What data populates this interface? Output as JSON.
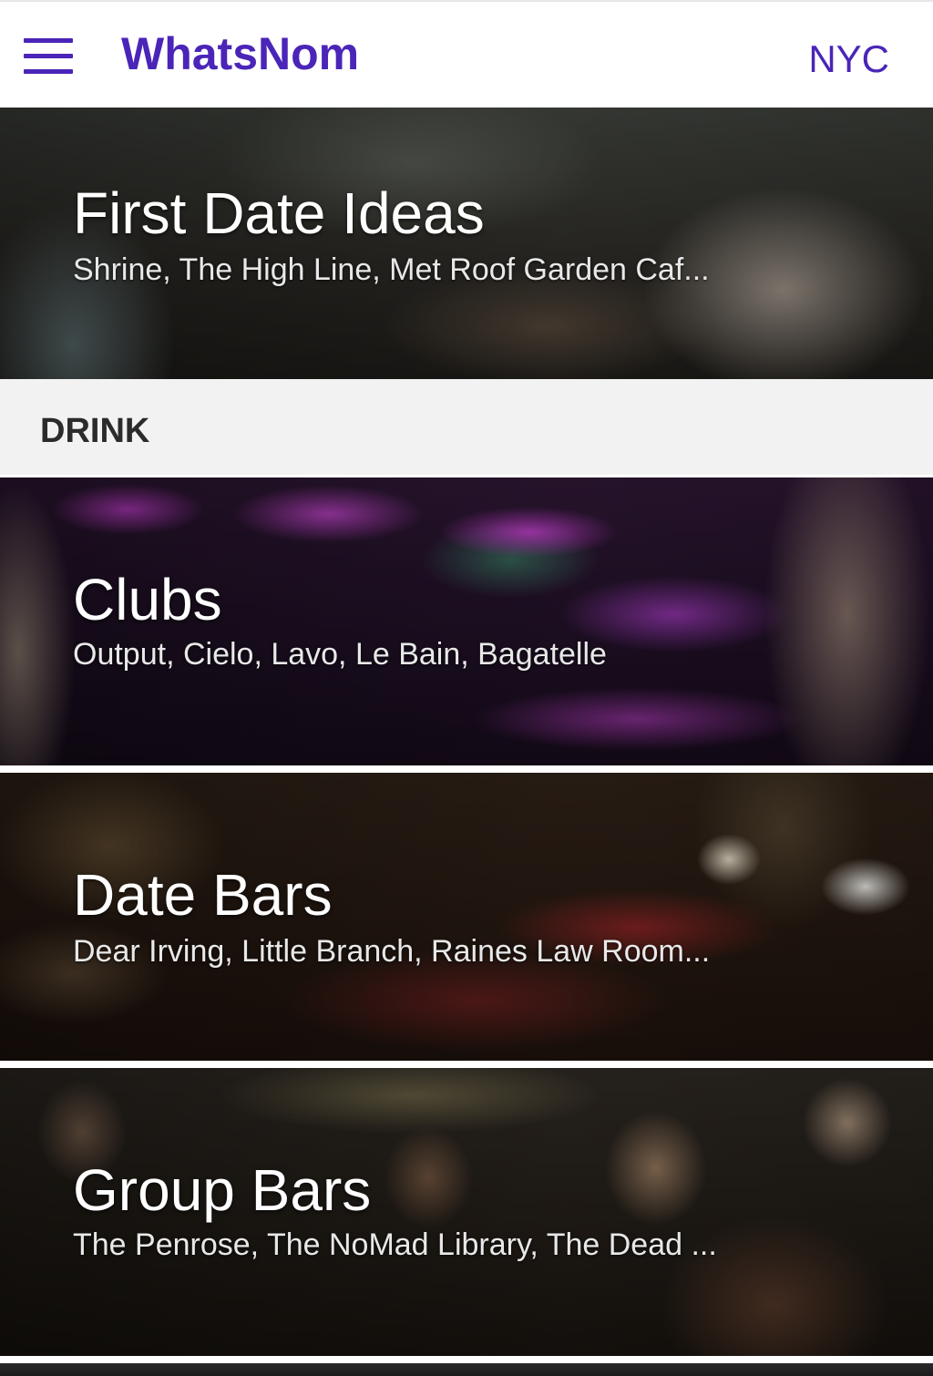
{
  "appbar": {
    "title": "WhatsNom",
    "city": "NYC",
    "menu_icon": "hamburger-menu-icon"
  },
  "featured": {
    "title": "First Date Ideas",
    "subtitle": "Shrine, The High Line, Met Roof Garden Caf..."
  },
  "section": {
    "label": "DRINK"
  },
  "cards": [
    {
      "title": "Clubs",
      "subtitle": "Output, Cielo, Lavo, Le Bain, Bagatelle"
    },
    {
      "title": "Date Bars",
      "subtitle": "Dear Irving, Little Branch, Raines Law Room..."
    },
    {
      "title": "Group Bars",
      "subtitle": "The Penrose, The NoMad Library, The Dead ..."
    }
  ],
  "colors": {
    "brand": "#4a25b8",
    "section_bg": "#f2f2f2",
    "section_text": "#2b2b2b"
  }
}
